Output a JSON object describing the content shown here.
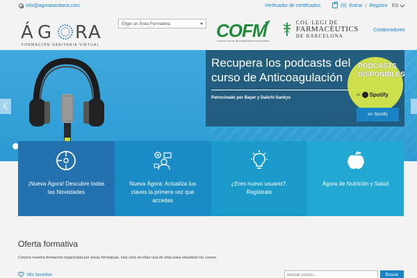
{
  "topbar": {
    "email": "info@agorasanitaria.com",
    "verifier": "Verificador de certificados",
    "cart_count": "(0)",
    "login": "Entrar",
    "separator": "|",
    "register": "Registro",
    "language": "ES"
  },
  "header": {
    "logo_agora_word": "ÁGORA",
    "logo_agora_sub": "FORMACIÓN SANITARIA VIRTUAL",
    "area_select_placeholder": "Elige un Área Formativa",
    "logo_cofm_word": "COFM",
    "logo_cofm_sub": "COLEGIO OFICIAL DE FARMACÉUTICOS DE MADRID",
    "logo_colegi_l1": "COL·LEGI DE",
    "logo_colegi_l2": "FARMACÈUTICS",
    "logo_colegi_l3": "DE BARCELONA",
    "collaborators": "Colaboradores"
  },
  "hero": {
    "title": "Recupera los podcasts del curso de Anticoagulación",
    "sponsor": "Patrocinado por Bayer y Daiichi-Sankyo",
    "badge_text": "PODCASTS DISPONIBLES",
    "badge_platform": "Spotify",
    "badge_prefix": "en",
    "button_label": "en Spotify"
  },
  "features": [
    {
      "label": "¡Nueva Ágora! Descubre todas las Novedades",
      "icon": "compass-icon"
    },
    {
      "label": "Nueva Ágora: Actualiza tus claves la primera vez que accedas",
      "icon": "user-settings-icon"
    },
    {
      "label": "¿Eres nuevo usuario?. Regístrate",
      "icon": "lightbulb-icon"
    },
    {
      "label": "Ágora de Nutrición y Salud",
      "icon": "apple-icon"
    }
  ],
  "oferta": {
    "title": "Oferta formativa",
    "description": "Conoce nuestra formación organizada por áreas formativas. Haz click en ellas una de ellas para visualizar los cursos.",
    "favorites": "Mis favoritos",
    "search_placeholder": "Buscar cursos...",
    "search_button": "Buscar"
  },
  "colors": {
    "accent": "#1a83c6",
    "hero_bg": "#3fa9dd",
    "card1": "#2471b0",
    "card2": "#1a8bc4",
    "card3": "#1b9bcc",
    "card4": "#22a8d3"
  }
}
